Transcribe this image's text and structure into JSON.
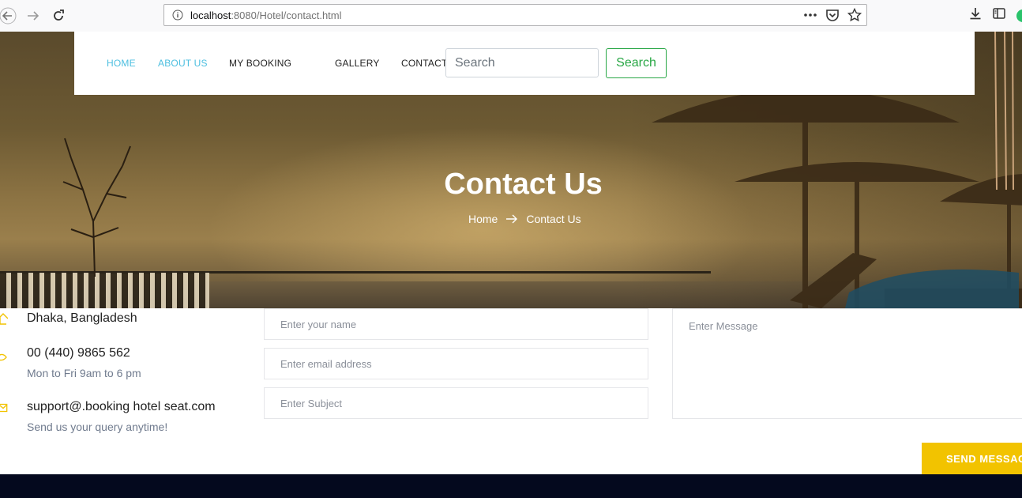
{
  "browser": {
    "url_host": "localhost",
    "url_rest": ":8080/Hotel/contact.html"
  },
  "nav": {
    "items": [
      {
        "label": "HOME",
        "active": true
      },
      {
        "label": "ABOUT US",
        "active": true
      },
      {
        "label": "MY BOOKING",
        "active": false
      },
      {
        "label": "GALLERY",
        "active": false
      },
      {
        "label": "CONTACT",
        "active": false
      }
    ],
    "search_placeholder": "Search",
    "search_button": "Search"
  },
  "hero": {
    "title": "Contact Us",
    "breadcrumb": [
      "Home",
      "Contact Us"
    ]
  },
  "contact_info": [
    {
      "icon": "home-icon",
      "title": "Dhaka, Bangladesh",
      "subtitle": ""
    },
    {
      "icon": "phone-icon",
      "title": "00 (440) 9865 562",
      "subtitle": "Mon to Fri 9am to 6 pm"
    },
    {
      "icon": "mail-icon",
      "title": "support@.booking hotel seat.com",
      "subtitle": "Send us your query anytime!"
    }
  ],
  "form": {
    "name_placeholder": "Enter your name",
    "email_placeholder": "Enter email address",
    "subject_placeholder": "Enter Subject",
    "message_placeholder": "Enter Message",
    "send_label": "SEND MESSAGE"
  },
  "colors": {
    "accent_yellow": "#f2c300",
    "nav_active": "#4dbfe0",
    "search_green": "#28a745",
    "footer": "#04091e"
  }
}
